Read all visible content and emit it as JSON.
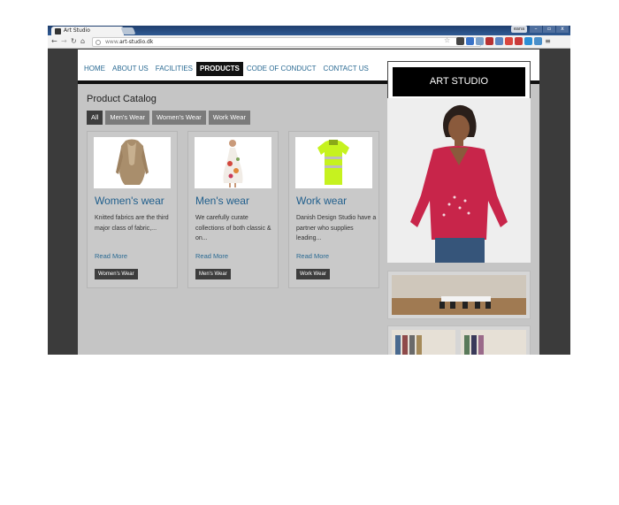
{
  "browser": {
    "tab_title": "Art Studio",
    "url_prefix": "www.",
    "url_domain": "art-studio.dk",
    "user_badge": "eana",
    "window_controls": [
      "–",
      "▫",
      "x"
    ]
  },
  "nav": {
    "items": [
      "HOME",
      "ABOUT US",
      "FACILITIES",
      "PRODUCTS",
      "CODE OF CONDUCT",
      "CONTACT US"
    ],
    "active": "PRODUCTS"
  },
  "logo": {
    "text": "ART STUDIO"
  },
  "catalog": {
    "title": "Product Catalog",
    "filters": [
      "All",
      "Men's Wear",
      "Women's Wear",
      "Work Wear"
    ],
    "active_filter": "All",
    "cards": [
      {
        "title": "Women's wear",
        "description": "Knitted fabrics are the third major class of fabric,...",
        "read_more": "Read More",
        "tag": "Women's Wear",
        "image": "beige-knit-cardigan"
      },
      {
        "title": "Men's wear",
        "description": "We carefully curate collections of both classic & on...",
        "read_more": "Read More",
        "tag": "Men's Wear",
        "image": "floral-dress-model"
      },
      {
        "title": "Work wear",
        "description": "Danish Design Studio have a partner who supplies leading...",
        "read_more": "Read More",
        "tag": "Work Wear",
        "image": "hi-vis-polo-shirt"
      }
    ]
  },
  "sidebar": {
    "hero_image": "model-in-red-top",
    "thumbnails": [
      "meeting-room",
      "clothing-racks"
    ]
  },
  "colors": {
    "link": "#2a6a93",
    "content_bg": "#c5c5c5",
    "dark": "#111111"
  }
}
